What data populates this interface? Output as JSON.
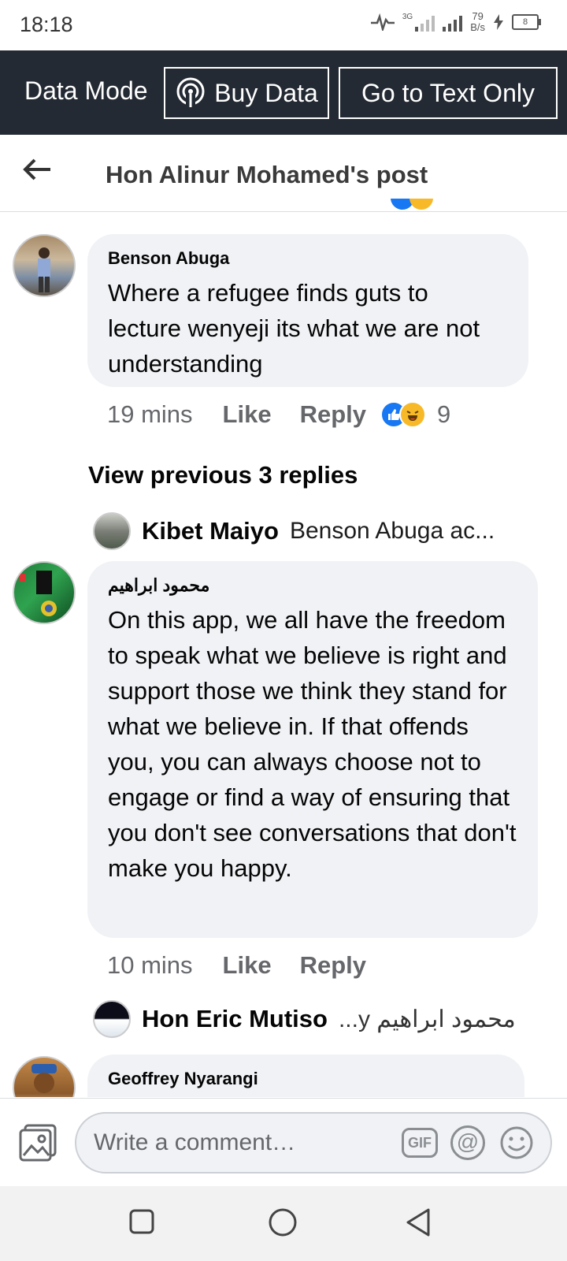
{
  "status_bar": {
    "time": "18:18",
    "network": "3G",
    "speed_value": "79",
    "speed_unit": "B/s",
    "battery": "8"
  },
  "data_bar": {
    "mode_label": "Data Mode",
    "buy_label": "Buy Data",
    "text_only_label": "Go to Text Only"
  },
  "header": {
    "title": "Hon Alinur Mohamed's post"
  },
  "comments": [
    {
      "author": "Benson Abuga",
      "text": "Where a refugee finds guts to lecture wenyeji its what we are not understanding",
      "time": "19 mins",
      "like_label": "Like",
      "reply_label": "Reply",
      "reaction_count": "9",
      "view_previous": "View previous 3 replies",
      "reply_preview": {
        "name": "Kibet Maiyo",
        "snippet": "Benson Abuga ac..."
      }
    },
    {
      "author": "محمود ابراهيم",
      "text": "On this app, we all have the freedom to speak what we believe is right and support those we think they stand for what we believe in. If that offends you, you can always choose not to engage or find a way of ensuring that you don't see conversations that don't make you happy.",
      "time": "10 mins",
      "like_label": "Like",
      "reply_label": "Reply",
      "reply_preview": {
        "name": "Hon Eric Mutiso",
        "snippet": "...y محمود ابراهيم"
      }
    },
    {
      "author": "Geoffrey Nyarangi"
    }
  ],
  "composer": {
    "placeholder": "Write a comment…",
    "gif_label": "GIF",
    "at_label": "@"
  },
  "colors": {
    "data_bar_bg": "#242a33",
    "bubble_bg": "#f0f2f5",
    "meta_text": "#65676b",
    "like_blue": "#1877f2",
    "haha_yellow": "#f7b928"
  }
}
